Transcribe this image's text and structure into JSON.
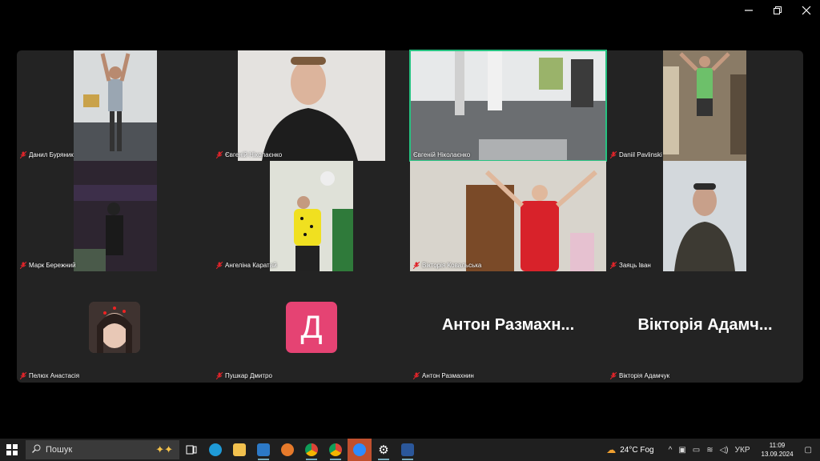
{
  "window": {
    "minimize_icon": "minimize-icon",
    "restore_icon": "restore-icon",
    "close_icon": "close-icon"
  },
  "participants": [
    {
      "name": "Данил Буряник",
      "mic": "muted",
      "video": true,
      "bg": "#bfc4c6"
    },
    {
      "name": "Євгеній Ніколаєнко",
      "mic": "muted",
      "video": true,
      "bg": "#d9d6d3"
    },
    {
      "name": "Євгеній Ніколаєнко",
      "mic": "muted",
      "video": true,
      "bg": "#9fa4a7",
      "active_speaker": true
    },
    {
      "name": "Daniil Pavlinski",
      "mic": "muted",
      "video": true,
      "bg": "#7e7260"
    },
    {
      "name": "Марк Бережний",
      "mic": "muted",
      "video": true,
      "bg": "#3a2f36"
    },
    {
      "name": "Ангеліна Каратай",
      "mic": "muted",
      "video": true,
      "bg": "#cfd3c2"
    },
    {
      "name": "Вікторія Ковальська",
      "mic": "muted",
      "video": true,
      "bg": "#c9c5bc"
    },
    {
      "name": "Заяць Іван",
      "mic": "muted",
      "video": true,
      "bg": "#c8cdd2"
    },
    {
      "name": "Пелюх Анастасія",
      "mic": "muted",
      "video": false,
      "avatar": "photo"
    },
    {
      "name": "Пушкар Дмитро",
      "mic": "muted",
      "video": false,
      "avatar_letter": "Д"
    },
    {
      "name": "Антон Размахнин",
      "mic": "muted",
      "video": false,
      "display_name": "Антон  Размахн..."
    },
    {
      "name": "Вікторія Адамчук",
      "mic": "muted",
      "video": false,
      "display_name": "Вікторія  Адамч..."
    }
  ],
  "taskbar": {
    "search_placeholder": "Пошук",
    "apps": [
      "task-view-icon",
      "edge-icon",
      "file-explorer-icon",
      "app-icon",
      "paint-icon",
      "chrome-icon",
      "chrome-alt-icon",
      "zoom-icon",
      "settings-icon",
      "word-icon"
    ],
    "weather": "24°C  Fog",
    "language": "УКР",
    "time": "11:09",
    "date": "13.09.2024"
  },
  "colors": {
    "active_border": "#26c281",
    "avatar_pink": "#e54373",
    "mute_red": "#e0242a"
  }
}
